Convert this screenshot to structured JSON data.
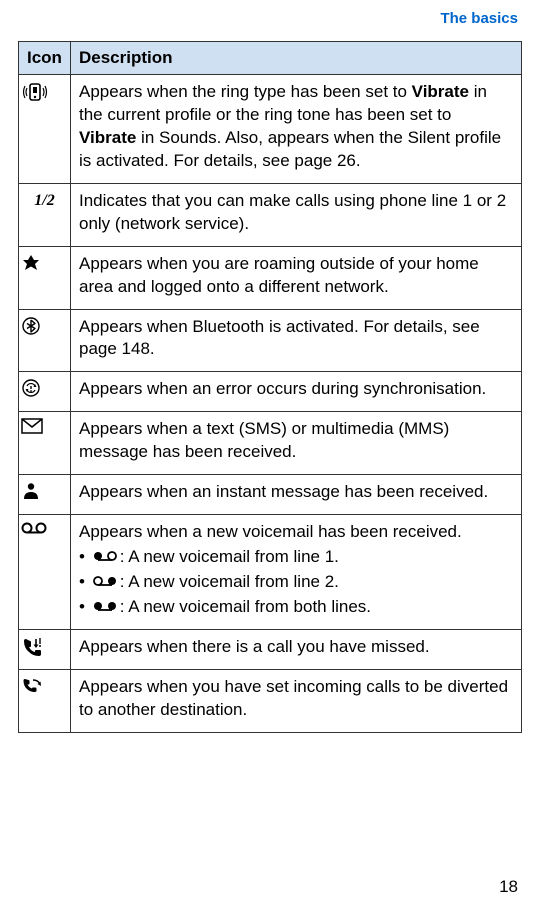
{
  "breadcrumb": "The basics",
  "page_number": "18",
  "headers": {
    "icon": "Icon",
    "description": "Description"
  },
  "rows": {
    "vibrate": {
      "pre": "Appears when the ring type has been set to ",
      "b1": "Vibrate",
      "mid": " in the current profile or the ring tone has been set to ",
      "b2": "Vibrate",
      "post": " in Sounds. Also, appears when the Silent profile is activated. For details, see page 26."
    },
    "line12": "Indicates that you can make calls using phone line 1 or 2 only (network service).",
    "roaming": "Appears when you are roaming outside of your home area and logged onto a different network.",
    "bluetooth": "Appears when Bluetooth is activated. For details, see page 148.",
    "syncerr": "Appears when an error occurs during synchronisation.",
    "message": "Appears when a text (SMS) or multimedia (MMS) message has been received.",
    "im": "Appears when an instant message has been received.",
    "voicemail": {
      "main": "Appears when a new voicemail has been received.",
      "l1": ": A new voicemail from line 1.",
      "l2": ": A new voicemail from line 2.",
      "l3": ": A new voicemail from both lines."
    },
    "missed": "Appears when there is a call you have missed.",
    "divert": "Appears when you have set incoming calls to be diverted to another destination."
  },
  "line12_text": "1/2"
}
